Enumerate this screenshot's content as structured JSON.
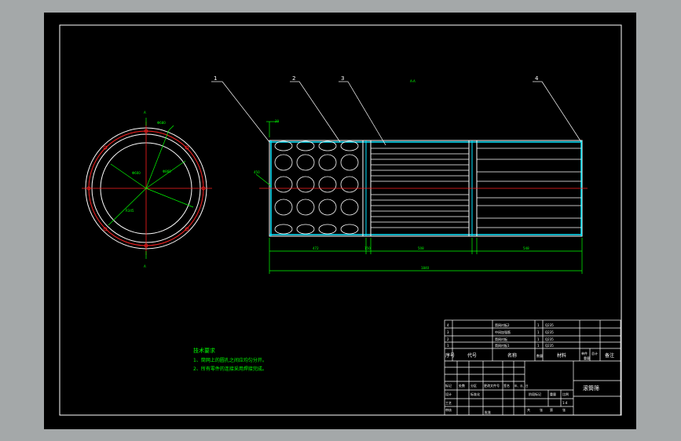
{
  "colors": {
    "background": "#a4a8a9",
    "paper": "#000000",
    "line": "#ffffff",
    "center": "#ff2020",
    "dim": "#00ff00",
    "cyan": "#00e5ff"
  },
  "callouts": [
    "1",
    "2",
    "3",
    "4"
  ],
  "top_mark": "A-A",
  "section_marks": [
    "A",
    "A"
  ],
  "dimensions": [
    "472",
    "150",
    "508",
    "548",
    "1840"
  ],
  "small_labels": [
    "20",
    "Φ680",
    "Φ860",
    "Φ600",
    "R345",
    "450"
  ],
  "notes": {
    "title": "技术要求",
    "lines": [
      "1、筒网上的圆孔之间应均匀分开。",
      "2、所有零件的连接采用焊接完成。"
    ]
  },
  "bom": {
    "rows": [
      {
        "no": "4",
        "name": "筒网衬板2",
        "qty": "1",
        "material": "Q235"
      },
      {
        "no": "3",
        "name": "中间加强筋",
        "qty": "1",
        "material": "Q235"
      },
      {
        "no": "2",
        "name": "筒网衬板",
        "qty": "1",
        "material": "Q235"
      },
      {
        "no": "1",
        "name": "筒网衬板1",
        "qty": "1",
        "material": "Q235"
      }
    ],
    "header": [
      "序号",
      "代号",
      "名称",
      "数量",
      "材料",
      "单件",
      "总计",
      "备注"
    ],
    "header_sub": "重量"
  },
  "title_block": {
    "drawing_title": "滚筒筛",
    "scale": "1:4",
    "cells": [
      "标记",
      "处数",
      "分区",
      "更改文件号",
      "签名",
      "年、月、日",
      "设计",
      "标准化",
      "阶段标记",
      "重量",
      "比例",
      "审核",
      "工艺",
      "批准",
      "共",
      "张",
      "第",
      "张"
    ]
  }
}
